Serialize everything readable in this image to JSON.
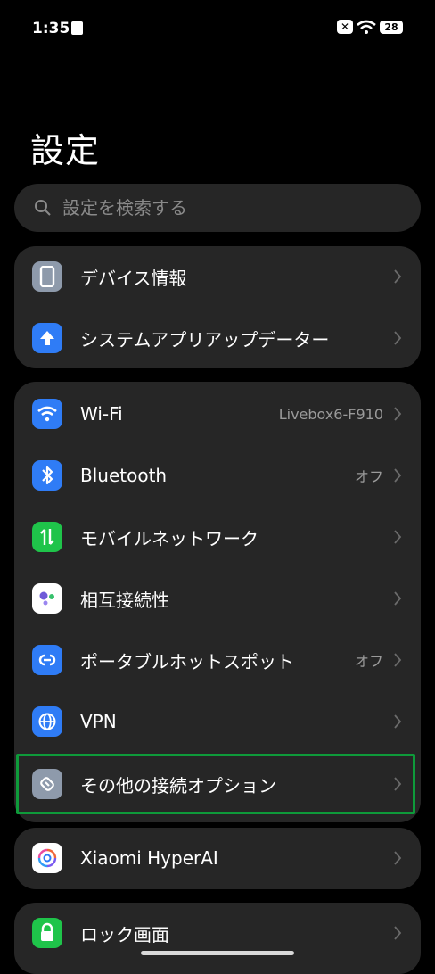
{
  "status_bar": {
    "time": "1:35",
    "battery": "28"
  },
  "page": {
    "title": "設定"
  },
  "search": {
    "placeholder": "設定を検索する"
  },
  "groups": [
    {
      "items": [
        {
          "label": "デバイス情報",
          "icon": "device-info-icon",
          "color": "#8e9aab"
        },
        {
          "label": "システムアプリアップデーター",
          "icon": "system-update-icon",
          "color": "#2f7cf6"
        }
      ]
    },
    {
      "items": [
        {
          "label": "Wi-Fi",
          "value": "Livebox6-F910",
          "icon": "wifi-icon",
          "color": "#2f7cf6"
        },
        {
          "label": "Bluetooth",
          "value": "オフ",
          "icon": "bluetooth-icon",
          "color": "#2f7cf6"
        },
        {
          "label": "モバイルネットワーク",
          "icon": "mobile-network-icon",
          "color": "#1fc44a"
        },
        {
          "label": "相互接続性",
          "icon": "interconnectivity-icon",
          "color": "#ffffff"
        },
        {
          "label": "ポータブルホットスポット",
          "value": "オフ",
          "icon": "hotspot-icon",
          "color": "#2f7cf6"
        },
        {
          "label": "VPN",
          "icon": "vpn-icon",
          "color": "#2f7cf6"
        },
        {
          "label": "その他の接続オプション",
          "icon": "other-connection-icon",
          "color": "#8e9aab"
        }
      ]
    },
    {
      "items": [
        {
          "label": "Xiaomi HyperAI",
          "icon": "hyperai-icon",
          "color": "#ffffff"
        }
      ]
    },
    {
      "items": [
        {
          "label": "ロック画面",
          "icon": "lock-icon",
          "color": "#1fc44a"
        }
      ]
    }
  ]
}
